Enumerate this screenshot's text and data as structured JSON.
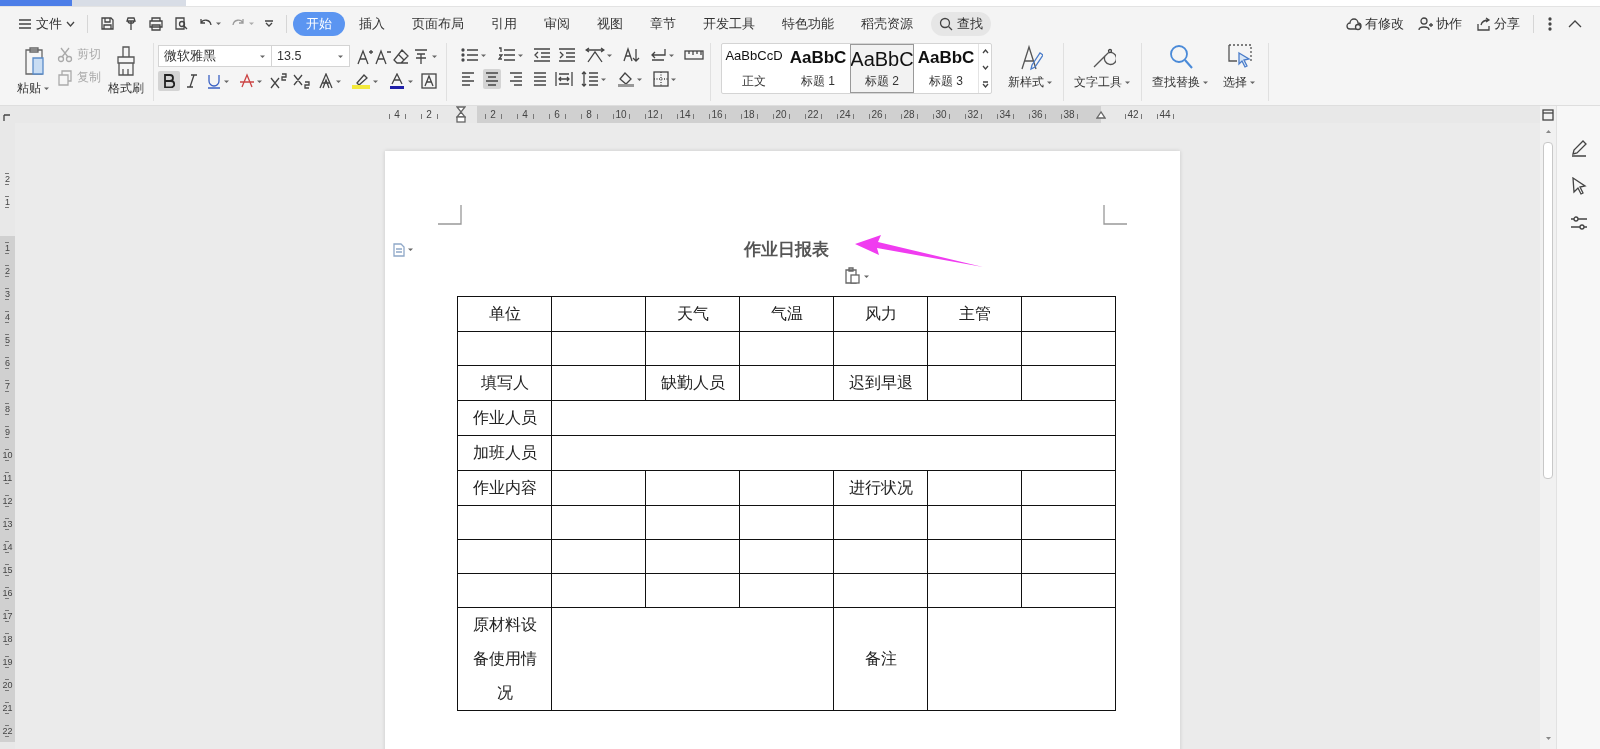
{
  "menu": {
    "file": "文件"
  },
  "tabs": [
    {
      "label": "开始",
      "selected": true
    },
    {
      "label": "插入",
      "selected": false
    },
    {
      "label": "页面布局",
      "selected": false
    },
    {
      "label": "引用",
      "selected": false
    },
    {
      "label": "审阅",
      "selected": false
    },
    {
      "label": "视图",
      "selected": false
    },
    {
      "label": "章节",
      "selected": false
    },
    {
      "label": "开发工具",
      "selected": false
    },
    {
      "label": "特色功能",
      "selected": false
    },
    {
      "label": "稻壳资源",
      "selected": false
    }
  ],
  "search": {
    "label": "查找"
  },
  "status_actions": [
    {
      "label": "有修改",
      "kind": "cloud"
    },
    {
      "label": "协作",
      "kind": "people"
    },
    {
      "label": "分享",
      "kind": "share"
    }
  ],
  "clipboard": {
    "paste": "粘贴",
    "cut": {
      "label": "剪切",
      "disabled": true
    },
    "copy": {
      "label": "复制",
      "disabled": true
    },
    "format_painter": "格式刷"
  },
  "font": {
    "name": "微软雅黑",
    "size": "13.5",
    "bold": true
  },
  "alignment": [
    {
      "kind": "left",
      "selected": false
    },
    {
      "kind": "center",
      "selected": true
    },
    {
      "kind": "right",
      "selected": false
    },
    {
      "kind": "justify",
      "selected": false
    }
  ],
  "styles": [
    {
      "preview": "AaBbCcD",
      "label": "正文",
      "kind": "body",
      "selected": false
    },
    {
      "preview": "AaBbC",
      "label": "标题 1",
      "kind": "heading1",
      "selected": false
    },
    {
      "preview": "AaBbC",
      "label": "标题 2",
      "kind": "heading2",
      "selected": true
    },
    {
      "preview": "AaBbC",
      "label": "标题 3",
      "kind": "heading3",
      "selected": false
    }
  ],
  "tools": {
    "new_style": "新样式",
    "text_tools": "文字工具",
    "find_replace": "查找替换",
    "select": "选择"
  },
  "ruler": {
    "left_labels": [
      "4",
      "2"
    ],
    "labels": [
      "2",
      "4",
      "6",
      "8",
      "10",
      "12",
      "14",
      "16",
      "18",
      "20",
      "22",
      "24",
      "26",
      "28",
      "30",
      "32",
      "34",
      "36",
      "38"
    ],
    "right_labels": [
      "42",
      "44"
    ]
  },
  "vertical_ruler": {
    "top_labels": [
      "2",
      "1"
    ],
    "labels": [
      "1",
      "2",
      "3",
      "4",
      "5",
      "6",
      "7",
      "8",
      "9",
      "10",
      "11",
      "12",
      "13",
      "14",
      "15",
      "16",
      "17",
      "18",
      "19",
      "20",
      "21",
      "22"
    ]
  },
  "document": {
    "title": "作业日报表",
    "table": {
      "rows": [
        {
          "cells": [
            {
              "text": "单位"
            },
            {},
            {
              "text": "天气"
            },
            {
              "text": "气温"
            },
            {
              "text": "风力"
            },
            {
              "text": "主管"
            },
            {}
          ]
        },
        {
          "cells": [
            {},
            {},
            {},
            {},
            {},
            {},
            {}
          ]
        },
        {
          "cells": [
            {
              "text": "填写人"
            },
            {},
            {
              "text": "缺勤人员"
            },
            {},
            {
              "text": "迟到早退"
            },
            {},
            {}
          ]
        },
        {
          "cells": [
            {
              "text": "作业人员"
            },
            {
              "colspan": 6
            }
          ]
        },
        {
          "cells": [
            {
              "text": "加班人员"
            },
            {
              "colspan": 6
            }
          ]
        },
        {
          "cells": [
            {
              "text": "作业内容"
            },
            {},
            {},
            {},
            {
              "text": "进行状况"
            },
            {},
            {}
          ]
        },
        {
          "cells": [
            {},
            {},
            {},
            {},
            {},
            {},
            {}
          ]
        },
        {
          "cells": [
            {},
            {},
            {},
            {},
            {},
            {},
            {}
          ]
        },
        {
          "cells": [
            {},
            {},
            {},
            {},
            {},
            {},
            {}
          ]
        },
        {
          "cells": [
            {
              "text": "原材料设备使用情况"
            },
            {
              "colspan": 3
            },
            {
              "text": "备注"
            },
            {
              "colspan": 2
            }
          ]
        }
      ]
    }
  }
}
